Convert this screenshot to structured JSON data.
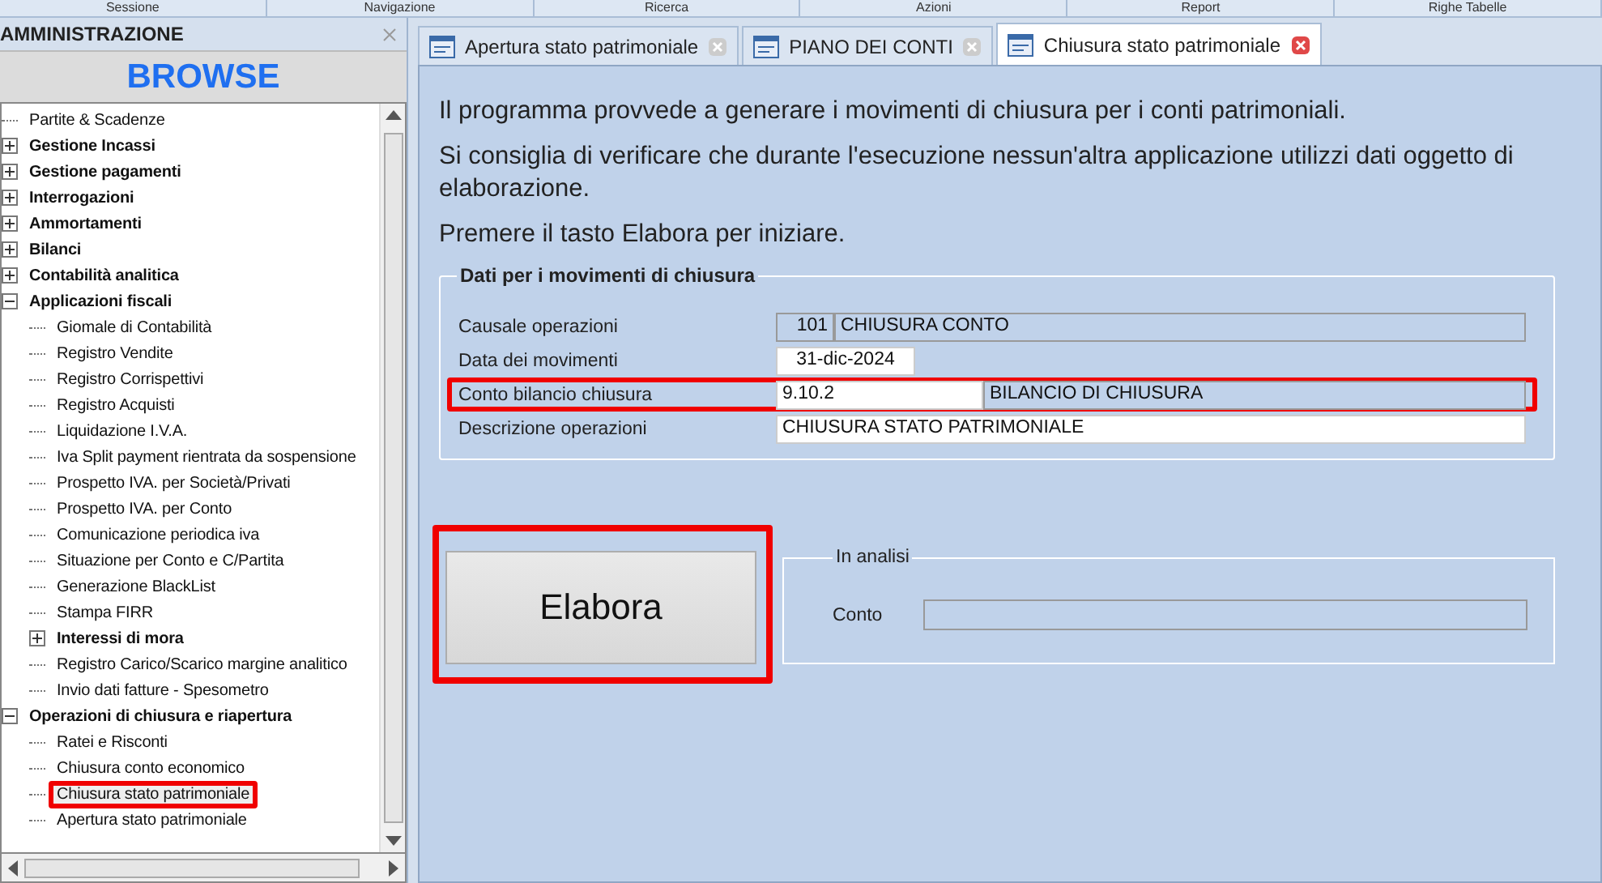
{
  "ribbon_groups": [
    "Sessione",
    "Navigazione",
    "Ricerca",
    "Azioni",
    "Report",
    "Righe Tabelle"
  ],
  "panel": {
    "title": "AMMINISTRAZIONE",
    "browse": "BROWSE"
  },
  "tree": [
    {
      "label": "Partite & Scadenze",
      "kind": "item",
      "selected": false
    },
    {
      "label": "Gestione Incassi",
      "kind": "folder",
      "expanded": false,
      "selected": false
    },
    {
      "label": "Gestione pagamenti",
      "kind": "folder",
      "expanded": false,
      "selected": false
    },
    {
      "label": "Interrogazioni",
      "kind": "folder",
      "expanded": false,
      "selected": false
    },
    {
      "label": "Ammortamenti",
      "kind": "folder",
      "expanded": false,
      "selected": false
    },
    {
      "label": "Bilanci",
      "kind": "folder",
      "expanded": false,
      "selected": false
    },
    {
      "label": "Contabilità analitica",
      "kind": "folder",
      "expanded": false,
      "selected": false
    },
    {
      "label": "Applicazioni fiscali",
      "kind": "folder",
      "expanded": true,
      "selected": false,
      "children": [
        {
          "label": "Giomale di Contabilità",
          "kind": "item",
          "selected": false
        },
        {
          "label": "Registro Vendite",
          "kind": "item",
          "selected": false
        },
        {
          "label": "Registro Corrispettivi",
          "kind": "item",
          "selected": false
        },
        {
          "label": "Registro Acquisti",
          "kind": "item",
          "selected": false
        },
        {
          "label": "Liquidazione I.V.A.",
          "kind": "item",
          "selected": false
        },
        {
          "label": "Iva Split payment rientrata da sospensione",
          "kind": "item",
          "selected": false
        },
        {
          "label": "Prospetto IVA. per Società/Privati",
          "kind": "item",
          "selected": false
        },
        {
          "label": "Prospetto IVA. per Conto",
          "kind": "item",
          "selected": false
        },
        {
          "label": "Comunicazione periodica iva",
          "kind": "item",
          "selected": false
        },
        {
          "label": "Situazione per Conto e C/Partita",
          "kind": "item",
          "selected": false
        },
        {
          "label": "Generazione BlackList",
          "kind": "item",
          "selected": false
        },
        {
          "label": "Stampa FIRR",
          "kind": "item",
          "selected": false
        },
        {
          "label": "Interessi di mora",
          "kind": "folder",
          "expanded": false,
          "selected": false
        },
        {
          "label": "Registro Carico/Scarico margine analitico",
          "kind": "item",
          "selected": false
        },
        {
          "label": "Invio dati fatture - Spesometro",
          "kind": "item",
          "selected": false
        }
      ]
    },
    {
      "label": "Operazioni di chiusura e riapertura",
      "kind": "folder",
      "expanded": true,
      "selected": false,
      "children": [
        {
          "label": "Ratei e Risconti",
          "kind": "item",
          "selected": false
        },
        {
          "label": "Chiusura conto economico",
          "kind": "item",
          "selected": false
        },
        {
          "label": "Chiusura stato patrimoniale",
          "kind": "item",
          "selected": true
        },
        {
          "label": "Apertura stato patrimoniale",
          "kind": "item",
          "selected": false
        }
      ]
    }
  ],
  "tabs": [
    {
      "label": "Apertura stato patrimoniale",
      "selected": false
    },
    {
      "label": "PIANO DEI CONTI",
      "selected": false
    },
    {
      "label": "Chiusura stato patrimoniale",
      "selected": true
    }
  ],
  "intro": [
    "Il programma provvede a generare i movimenti di chiusura per i conti patrimoniali.",
    "Si consiglia di verificare che durante l'esecuzione nessun'altra applicazione utilizzi dati oggetto di elaborazione.",
    "Premere il tasto Elabora per iniziare."
  ],
  "form": {
    "title": "Dati per i movimenti di chiusura",
    "rows": [
      {
        "label": "Causale operazioni",
        "code": "101",
        "value": "CHIUSURA CONTO",
        "kind": "code",
        "highlighted": false
      },
      {
        "label": "Data dei movimenti",
        "value": "31-dic-2024",
        "kind": "date",
        "highlighted": false
      },
      {
        "label": "Conto bilancio chiusura",
        "code": "9.10.2",
        "value": "BILANCIO DI CHIUSURA",
        "kind": "account",
        "highlighted": true
      },
      {
        "label": "Descrizione operazioni",
        "value": "CHIUSURA STATO PATRIMONIALE",
        "kind": "text",
        "highlighted": false
      }
    ]
  },
  "elabora": {
    "label": "Elabora",
    "highlighted": true
  },
  "analysis": {
    "title": "In analisi",
    "label": "Conto"
  }
}
